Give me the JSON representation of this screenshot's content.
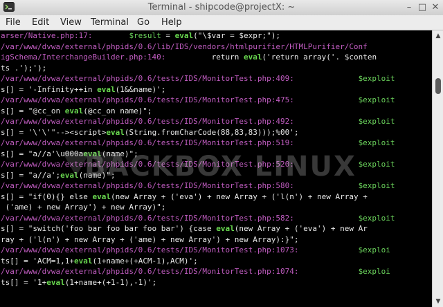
{
  "window": {
    "title": "Terminal - shipcode@projectX: ~"
  },
  "controls": {
    "minimize": "–",
    "maximize": "□",
    "close": "✕"
  },
  "menu": [
    "File",
    "Edit",
    "View",
    "Terminal",
    "Go",
    "Help"
  ],
  "watermark": {
    "text": "BACKBOX LINUX"
  },
  "icons": {
    "app": "terminal-icon",
    "scroll_up": "arrow-up-icon",
    "scroll_down": "arrow-down-icon"
  },
  "colors": {
    "path": "#c05cc0",
    "eval": "#69d84f",
    "text": "#e6e6e6",
    "background": "#000000"
  },
  "lines": [
    [
      {
        "t": "arser/Native.php:17:",
        "c": "path"
      },
      {
        "t": "        ",
        "c": "plain"
      },
      {
        "t": "$result",
        "c": "var"
      },
      {
        "t": " = ",
        "c": "plain"
      },
      {
        "t": "eval",
        "c": "eval"
      },
      {
        "t": "(\"\\$var = $expr;\");",
        "c": "plain"
      }
    ],
    [
      {
        "t": "/var/www/dvwa/external/phpids/0.6/lib/IDS/vendors/htmlpurifier/HTMLPurifier/Conf",
        "c": "path"
      }
    ],
    [
      {
        "t": "igSchema/InterchangeBuilder.php:140:",
        "c": "path"
      },
      {
        "t": "          return ",
        "c": "plain"
      },
      {
        "t": "eval",
        "c": "eval"
      },
      {
        "t": "('return array('. $conten",
        "c": "plain"
      }
    ],
    [
      {
        "t": "ts .');');",
        "c": "plain"
      }
    ],
    [
      {
        "t": "/var/www/dvwa/external/phpids/0.6/tests/IDS/MonitorTest.php:409:",
        "c": "path"
      },
      {
        "t": "              ",
        "c": "plain"
      },
      {
        "t": "$exploit",
        "c": "var"
      }
    ],
    [
      {
        "t": "s[] = '-Infinity++in ",
        "c": "plain"
      },
      {
        "t": "eval",
        "c": "eval"
      },
      {
        "t": "(1&&name)';",
        "c": "plain"
      }
    ],
    [
      {
        "t": "/var/www/dvwa/external/phpids/0.6/tests/IDS/MonitorTest.php:475:",
        "c": "path"
      },
      {
        "t": "              ",
        "c": "plain"
      },
      {
        "t": "$exploit",
        "c": "var"
      }
    ],
    [
      {
        "t": "s[] = \"@cc_on ",
        "c": "plain"
      },
      {
        "t": "eval",
        "c": "eval"
      },
      {
        "t": "(@cc_on name)\";",
        "c": "plain"
      }
    ],
    [
      {
        "t": "/var/www/dvwa/external/phpids/0.6/tests/IDS/MonitorTest.php:492:",
        "c": "path"
      },
      {
        "t": "              ",
        "c": "plain"
      },
      {
        "t": "$exploit",
        "c": "var"
      }
    ],
    [
      {
        "t": "s[] = '\\'\\'\"--><script>",
        "c": "plain"
      },
      {
        "t": "eval",
        "c": "eval"
      },
      {
        "t": "(String.fromCharCode(88,83,83)));%00';",
        "c": "plain"
      }
    ],
    [
      {
        "t": "/var/www/dvwa/external/phpids/0.6/tests/IDS/MonitorTest.php:519:",
        "c": "path"
      },
      {
        "t": "              ",
        "c": "plain"
      },
      {
        "t": "$exploit",
        "c": "var"
      }
    ],
    [
      {
        "t": "s[] = \"a//a'\\u000a",
        "c": "plain"
      },
      {
        "t": "eval",
        "c": "eval"
      },
      {
        "t": "(name)\";",
        "c": "plain"
      }
    ],
    [
      {
        "t": "/var/www/dvwa/external/phpids/0.6/tests/IDS/MonitorTest.php:520:",
        "c": "path"
      },
      {
        "t": "              ",
        "c": "plain"
      },
      {
        "t": "$exploit",
        "c": "var"
      }
    ],
    [
      {
        "t": "s[] = \"a//a';",
        "c": "plain"
      },
      {
        "t": "eval",
        "c": "eval"
      },
      {
        "t": "(name)\";",
        "c": "plain"
      }
    ],
    [
      {
        "t": "/var/www/dvwa/external/phpids/0.6/tests/IDS/MonitorTest.php:580:",
        "c": "path"
      },
      {
        "t": "              ",
        "c": "plain"
      },
      {
        "t": "$exploit",
        "c": "var"
      }
    ],
    [
      {
        "t": "s[] = \"if(0){} else ",
        "c": "plain"
      },
      {
        "t": "eval",
        "c": "eval"
      },
      {
        "t": "(new Array + ('eva') + new Array + ('l(n') + new Array +",
        "c": "plain"
      }
    ],
    [
      {
        "t": " ('ame) + new Array') + new Array)\";",
        "c": "plain"
      }
    ],
    [
      {
        "t": "/var/www/dvwa/external/phpids/0.6/tests/IDS/MonitorTest.php:582:",
        "c": "path"
      },
      {
        "t": "              ",
        "c": "plain"
      },
      {
        "t": "$exploit",
        "c": "var"
      }
    ],
    [
      {
        "t": "s[] = \"switch('foo bar foo bar foo bar') {case ",
        "c": "plain"
      },
      {
        "t": "eval",
        "c": "eval"
      },
      {
        "t": "(new Array + ('eva') + new Ar",
        "c": "plain"
      }
    ],
    [
      {
        "t": "ray + ('l(n') + new Array + ('ame) + new Array') + new Array):}\";",
        "c": "plain"
      }
    ],
    [
      {
        "t": "/var/www/dvwa/external/phpids/0.6/tests/IDS/MonitorTest.php:1073:",
        "c": "path"
      },
      {
        "t": "             ",
        "c": "plain"
      },
      {
        "t": "$exploi",
        "c": "var"
      }
    ],
    [
      {
        "t": "ts[] = 'ACM=1,1+",
        "c": "plain"
      },
      {
        "t": "eval",
        "c": "eval"
      },
      {
        "t": "(1+name+(+ACM-1),ACM)';",
        "c": "plain"
      }
    ],
    [
      {
        "t": "/var/www/dvwa/external/phpids/0.6/tests/IDS/MonitorTest.php:1074:",
        "c": "path"
      },
      {
        "t": "             ",
        "c": "plain"
      },
      {
        "t": "$exploi",
        "c": "var"
      }
    ],
    [
      {
        "t": "ts[] = '1+",
        "c": "plain"
      },
      {
        "t": "eval",
        "c": "eval"
      },
      {
        "t": "(1+name+(+1-1),-1)';",
        "c": "plain"
      }
    ]
  ]
}
